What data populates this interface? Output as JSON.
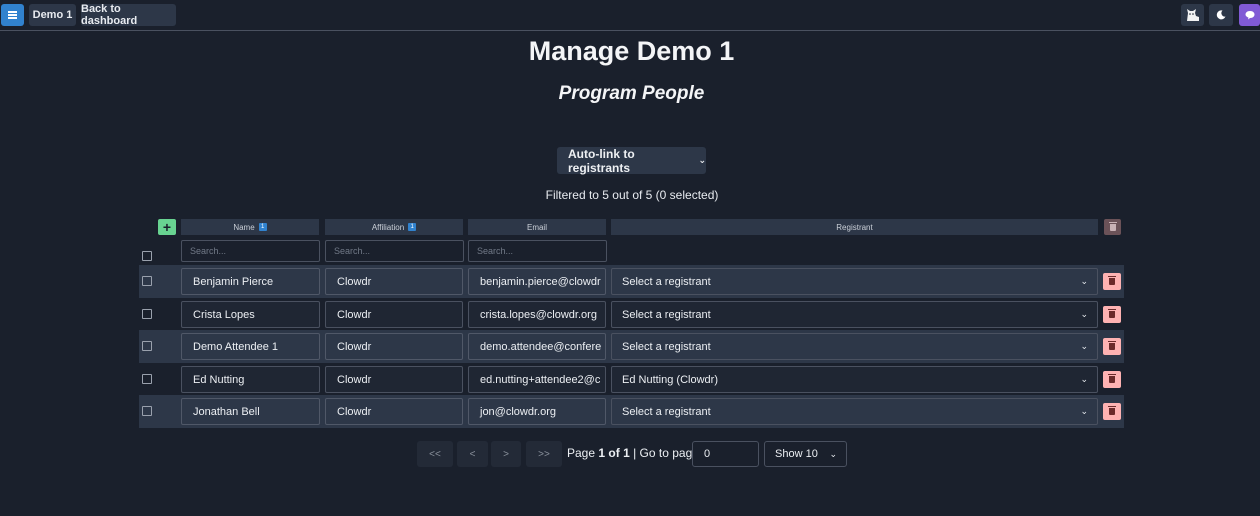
{
  "topbar": {
    "conference_label": "Demo 1",
    "back_label": "Back to dashboard"
  },
  "page": {
    "title": "Manage Demo 1",
    "subtitle": "Program People"
  },
  "actions": {
    "autolink_label": "Auto-link to registrants",
    "filtered_text": "Filtered to 5 out of 5 (0 selected)",
    "add_label": "+"
  },
  "columns": {
    "name": "Name",
    "affiliation": "Affiliation",
    "email": "Email",
    "registrant": "Registrant",
    "name_sort": "1",
    "affiliation_sort": "1"
  },
  "search": {
    "placeholder": "Search..."
  },
  "rows": [
    {
      "name": "Benjamin Pierce",
      "affiliation": "Clowdr",
      "email": "benjamin.pierce@clowdr",
      "registrant": "Select a registrant"
    },
    {
      "name": "Crista Lopes",
      "affiliation": "Clowdr",
      "email": "crista.lopes@clowdr.org",
      "registrant": "Select a registrant"
    },
    {
      "name": "Demo Attendee 1",
      "affiliation": "Clowdr",
      "email": "demo.attendee@confere",
      "registrant": "Select a registrant"
    },
    {
      "name": "Ed Nutting",
      "affiliation": "Clowdr",
      "email": "ed.nutting+attendee2@c",
      "registrant": "Ed Nutting (Clowdr)"
    },
    {
      "name": "Jonathan Bell",
      "affiliation": "Clowdr",
      "email": "jon@clowdr.org",
      "registrant": "Select a registrant"
    }
  ],
  "pagination": {
    "first": "<<",
    "prev": "<",
    "next": ">",
    "last": ">>",
    "page_word": "Page",
    "current_page": "1",
    "of_word": "of",
    "total_pages": "1",
    "goto_label": "| Go to page:",
    "goto_value": "0",
    "show_label": "Show 10"
  }
}
